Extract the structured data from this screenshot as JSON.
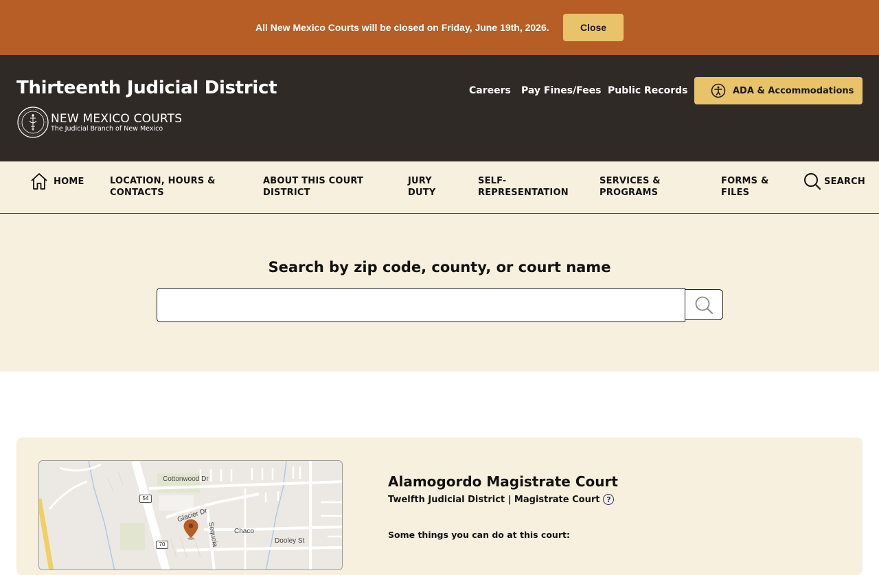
{
  "alert": {
    "message": "All New Mexico Courts will be closed on Friday, June 19th, 2026.",
    "close_label": "Close"
  },
  "header": {
    "title": "Thirteenth Judicial District",
    "brand_name": "NEW MEXICO COURTS",
    "brand_sub": "The Judicial Branch of New Mexico",
    "links": {
      "careers": "Careers",
      "pay": "Pay Fines/Fees",
      "records": "Public Records"
    },
    "ada_label": "ADA & Accommodations"
  },
  "nav": {
    "home": "HOME",
    "location": "LOCATION, HOURS & CONTACTS",
    "about": "ABOUT THIS COURT DISTRICT",
    "jury": "JURY DUTY",
    "self": "SELF-REPRESENTATION",
    "services": "SERVICES & PROGRAMS",
    "forms": "FORMS & FILES",
    "search": "SEARCH"
  },
  "search": {
    "heading": "Search by zip code, county, or court name",
    "value": "",
    "placeholder": ""
  },
  "result": {
    "court_name": "Alamogordo Magistrate Court",
    "district_line": "Twelfth Judicial District | Magistrate Court",
    "help_glyph": "?",
    "things_label": "Some things you can do at this court:",
    "map": {
      "streets": [
        "Cottonwood Dr",
        "Glacier Dr",
        "Sequoia",
        "Chaco",
        "Dooley St"
      ],
      "shields": [
        "54",
        "70"
      ]
    }
  },
  "colors": {
    "alert_bg": "#b65e26",
    "header_bg": "#302a27",
    "accent_gold": "#e8c36a",
    "cream": "#f8f0de",
    "pin": "#b65e26"
  }
}
